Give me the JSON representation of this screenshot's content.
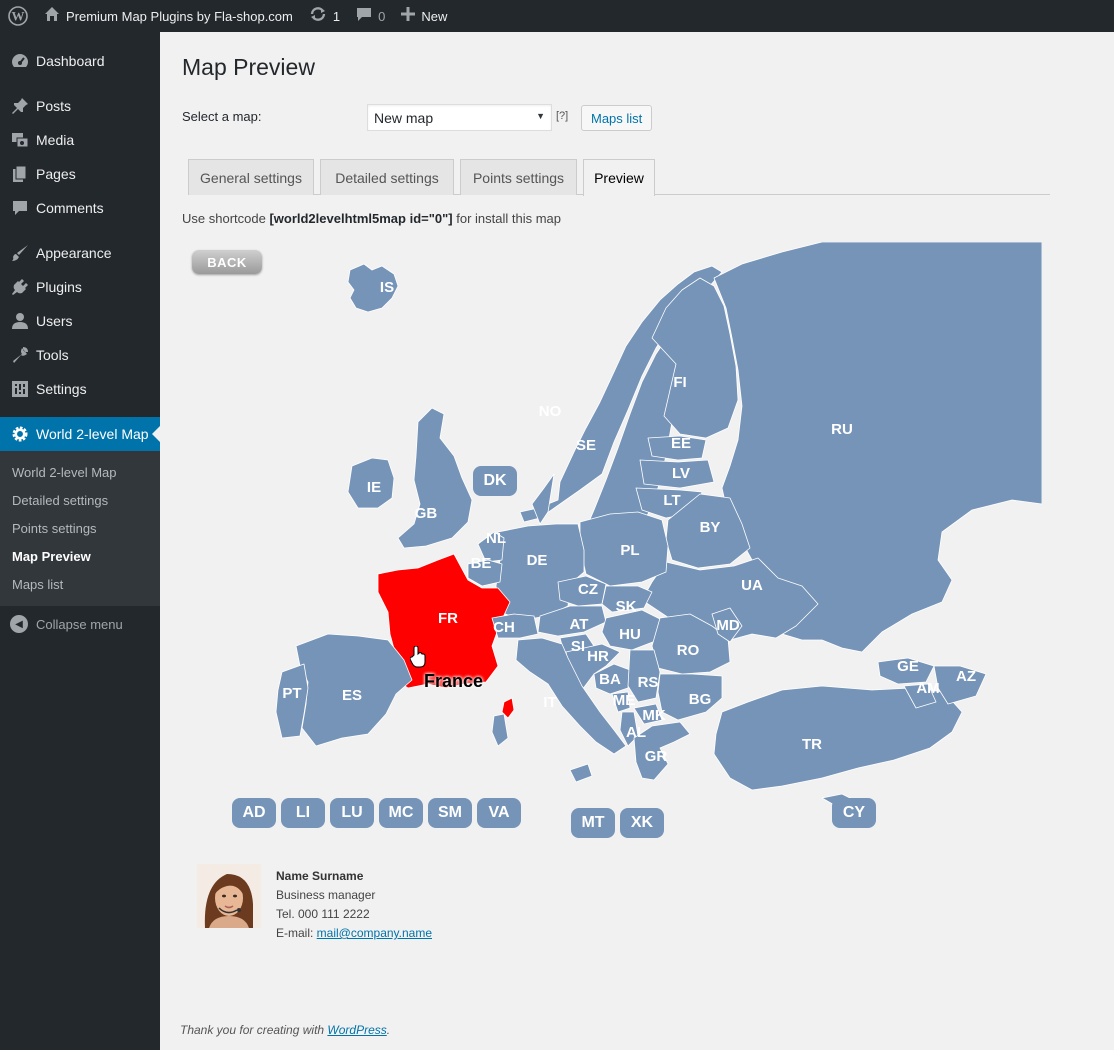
{
  "adminbar": {
    "site_name": "Premium Map Plugins by Fla-shop.com",
    "updates_count": "1",
    "comments_count": "0",
    "new_label": "New"
  },
  "sidebar": {
    "items": [
      {
        "label": "Dashboard",
        "icon": "dashboard-icon"
      },
      {
        "label": "Posts",
        "icon": "pin-icon"
      },
      {
        "label": "Media",
        "icon": "media-icon"
      },
      {
        "label": "Pages",
        "icon": "pages-icon"
      },
      {
        "label": "Comments",
        "icon": "comment-icon"
      },
      {
        "label": "Appearance",
        "icon": "brush-icon"
      },
      {
        "label": "Plugins",
        "icon": "plug-icon"
      },
      {
        "label": "Users",
        "icon": "user-icon"
      },
      {
        "label": "Tools",
        "icon": "wrench-icon"
      },
      {
        "label": "Settings",
        "icon": "sliders-icon"
      },
      {
        "label": "World 2-level Map",
        "icon": "gear-icon"
      }
    ],
    "submenu": [
      "World 2-level Map",
      "Detailed settings",
      "Points settings",
      "Map Preview",
      "Maps list"
    ],
    "collapse_label": "Collapse menu"
  },
  "page": {
    "title": "Map Preview",
    "select_label": "Select a map:",
    "select_value": "New map",
    "help_link": "[?]",
    "maps_list_button": "Maps list",
    "tabs": [
      "General settings",
      "Detailed settings",
      "Points settings",
      "Preview"
    ],
    "shortcode_prefix": "Use shortcode ",
    "shortcode_code": "[world2levelhtml5map id=\"0\"]",
    "shortcode_suffix": " for install this map"
  },
  "map": {
    "back_label": "BACK",
    "hovered_country": "France",
    "hover_color": "#ff0000",
    "country_color": "#7594b8",
    "country_labels": [
      "IS",
      "NO",
      "SE",
      "FI",
      "RU",
      "EE",
      "LV",
      "LT",
      "BY",
      "PL",
      "UA",
      "DK",
      "IE",
      "GB",
      "NL",
      "BE",
      "DE",
      "FR",
      "CH",
      "CZ",
      "SK",
      "AT",
      "HU",
      "SI",
      "HR",
      "RO",
      "MD",
      "BA",
      "RS",
      "ME",
      "MK",
      "AL",
      "BG",
      "GR",
      "IT",
      "ES",
      "PT",
      "TR",
      "GE",
      "AM",
      "AZ"
    ],
    "small_states": [
      "AD",
      "LI",
      "LU",
      "MC",
      "SM",
      "VA",
      "MT",
      "XK",
      "CY"
    ]
  },
  "contact": {
    "name": "Name Surname",
    "role": "Business manager",
    "phone": "Tel. 000 111 2222",
    "email_label": "E-mail: ",
    "email": "mail@company.name"
  },
  "footer": {
    "text": "Thank you for creating with ",
    "link": "WordPress",
    "end": "."
  }
}
